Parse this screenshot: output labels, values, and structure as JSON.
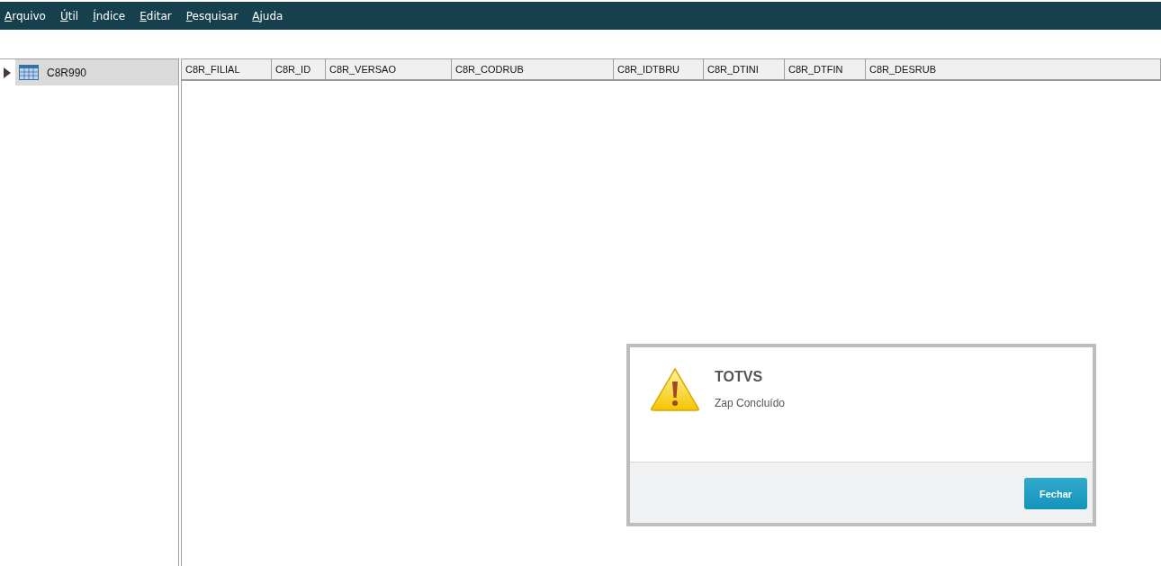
{
  "menu": [
    {
      "label": "Arquivo"
    },
    {
      "label": "Útil"
    },
    {
      "label": "Índice"
    },
    {
      "label": "Editar"
    },
    {
      "label": "Pesquisar"
    },
    {
      "label": "Ajuda"
    }
  ],
  "tree": [
    {
      "label": "C8R990",
      "expanded": false,
      "selected": true
    }
  ],
  "table": {
    "columns": [
      {
        "label": "C8R_FILIAL"
      },
      {
        "label": "C8R_ID"
      },
      {
        "label": "C8R_VERSAO"
      },
      {
        "label": "C8R_CODRUB"
      },
      {
        "label": "C8R_IDTBRU"
      },
      {
        "label": "C8R_DTINI"
      },
      {
        "label": "C8R_DTFIN"
      },
      {
        "label": "C8R_DESRUB"
      }
    ]
  },
  "dialog": {
    "title": "TOTVS",
    "message": "Zap Concluído",
    "button": "Fechar"
  }
}
